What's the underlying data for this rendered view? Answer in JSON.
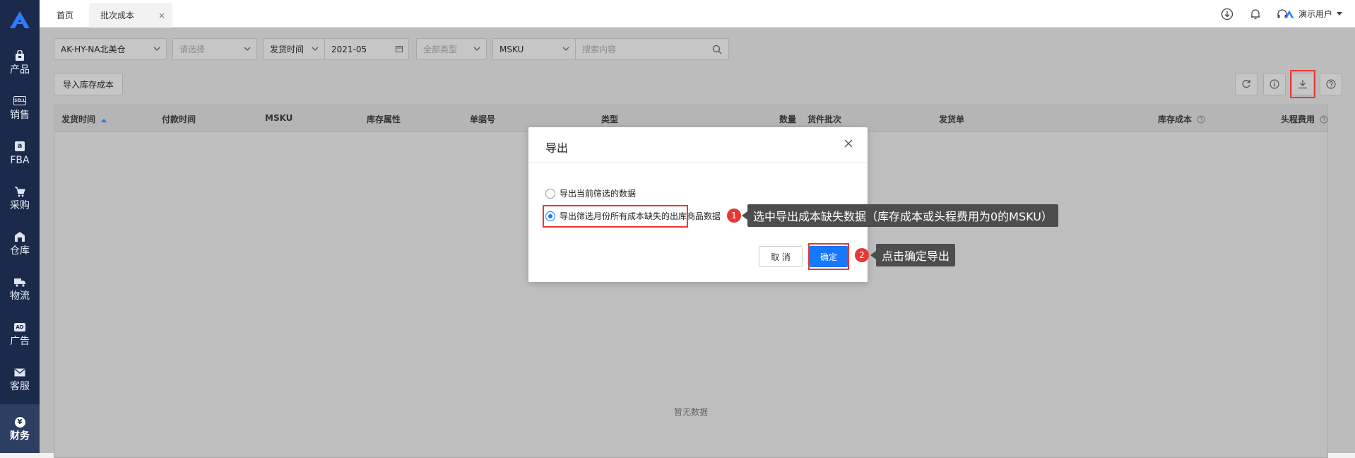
{
  "sidebar": {
    "items": [
      {
        "label": "产品",
        "icon": "bag-icon"
      },
      {
        "label": "销售",
        "icon": "sell-icon"
      },
      {
        "label": "FBA",
        "icon": "fba-icon"
      },
      {
        "label": "采购",
        "icon": "cart-icon"
      },
      {
        "label": "仓库",
        "icon": "warehouse-icon"
      },
      {
        "label": "物流",
        "icon": "truck-icon"
      },
      {
        "label": "广告",
        "icon": "ad-icon"
      },
      {
        "label": "客服",
        "icon": "mail-icon"
      },
      {
        "label": "财务",
        "icon": "finance-icon"
      }
    ],
    "ad_glyph": "AD",
    "sell_glyph": "SELL",
    "fba_glyph": "a",
    "finance_glyph": "¥"
  },
  "tabs": {
    "home": "首页",
    "active": "批次成本",
    "close": "×"
  },
  "user": {
    "name": "演示用户"
  },
  "filters": {
    "store": "AK-HY-NA北美仓",
    "select_placeholder": "请选择",
    "time_type": "发货时间",
    "month": "2021-05",
    "type_all": "全部类型",
    "sku_type": "MSKU",
    "search_placeholder": "搜索内容"
  },
  "import_button": "导入库存成本",
  "table": {
    "headers": [
      "发货时间",
      "付款时间",
      "MSKU",
      "库存属性",
      "单据号",
      "类型",
      "数量",
      "货件批次",
      "发货单",
      "库存成本",
      "头程费用"
    ],
    "empty": "暂无数据"
  },
  "modal": {
    "title": "导出",
    "options": [
      "导出当前筛选的数据",
      "导出筛选月份所有成本缺失的出库商品数据"
    ],
    "cancel": "取 消",
    "ok": "确定"
  },
  "callouts": [
    {
      "n": "1",
      "text": "选中导出成本缺失数据（库存成本或头程费用为0的MSKU）"
    },
    {
      "n": "2",
      "text": "点击确定导出"
    }
  ],
  "colors": {
    "sidebar": "#1b2a4a",
    "primary": "#1677ff",
    "highlight": "#e53935"
  }
}
